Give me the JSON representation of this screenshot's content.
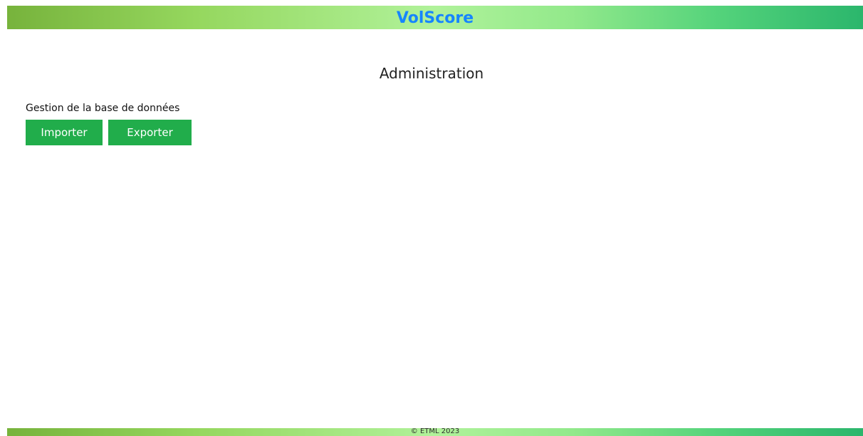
{
  "app": {
    "title": "VolScore",
    "colors": {
      "brand_text": "#1685ff",
      "button_bg": "#21ad4b"
    }
  },
  "page": {
    "title": "Administration"
  },
  "database": {
    "section_label": "Gestion de la base de données",
    "import_label": "Importer",
    "export_label": "Exporter"
  },
  "footer": {
    "copyright": "© ETML 2023"
  }
}
